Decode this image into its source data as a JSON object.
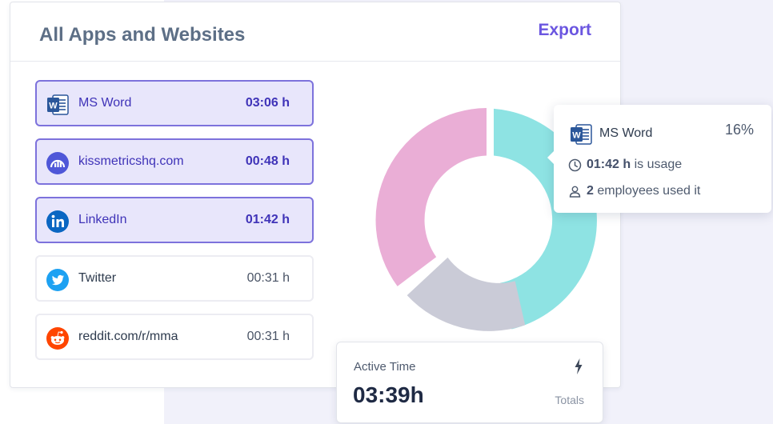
{
  "header": {
    "title": "All Apps and Websites",
    "export_label": "Export"
  },
  "apps": [
    {
      "name": "MS Word",
      "time": "03:06 h",
      "icon": "ms-word-icon",
      "selected": true
    },
    {
      "name": "kissmetricshq.com",
      "time": "00:48 h",
      "icon": "kissmetrics-icon",
      "selected": true
    },
    {
      "name": "LinkedIn",
      "time": "01:42 h",
      "icon": "linkedin-icon",
      "selected": true
    },
    {
      "name": "Twitter",
      "time": "00:31 h",
      "icon": "twitter-icon",
      "selected": false
    },
    {
      "name": "reddit.com/r/mma",
      "time": "00:31 h",
      "icon": "reddit-icon",
      "selected": false
    }
  ],
  "tooltip": {
    "name": "MS Word",
    "percent": "16%",
    "usage_value": "01:42 h",
    "usage_suffix": "is usage",
    "employees_value": "2",
    "employees_suffix": "employees used it"
  },
  "active_time": {
    "label": "Active Time",
    "value": "03:39h",
    "totals_label": "Totals"
  },
  "colors": {
    "accent": "#6b56e0",
    "selected_bg": "#e8e6fb",
    "segment_teal": "#8ee3e3",
    "segment_gray": "#cacbd7",
    "segment_pink": "#eaaed6"
  }
}
